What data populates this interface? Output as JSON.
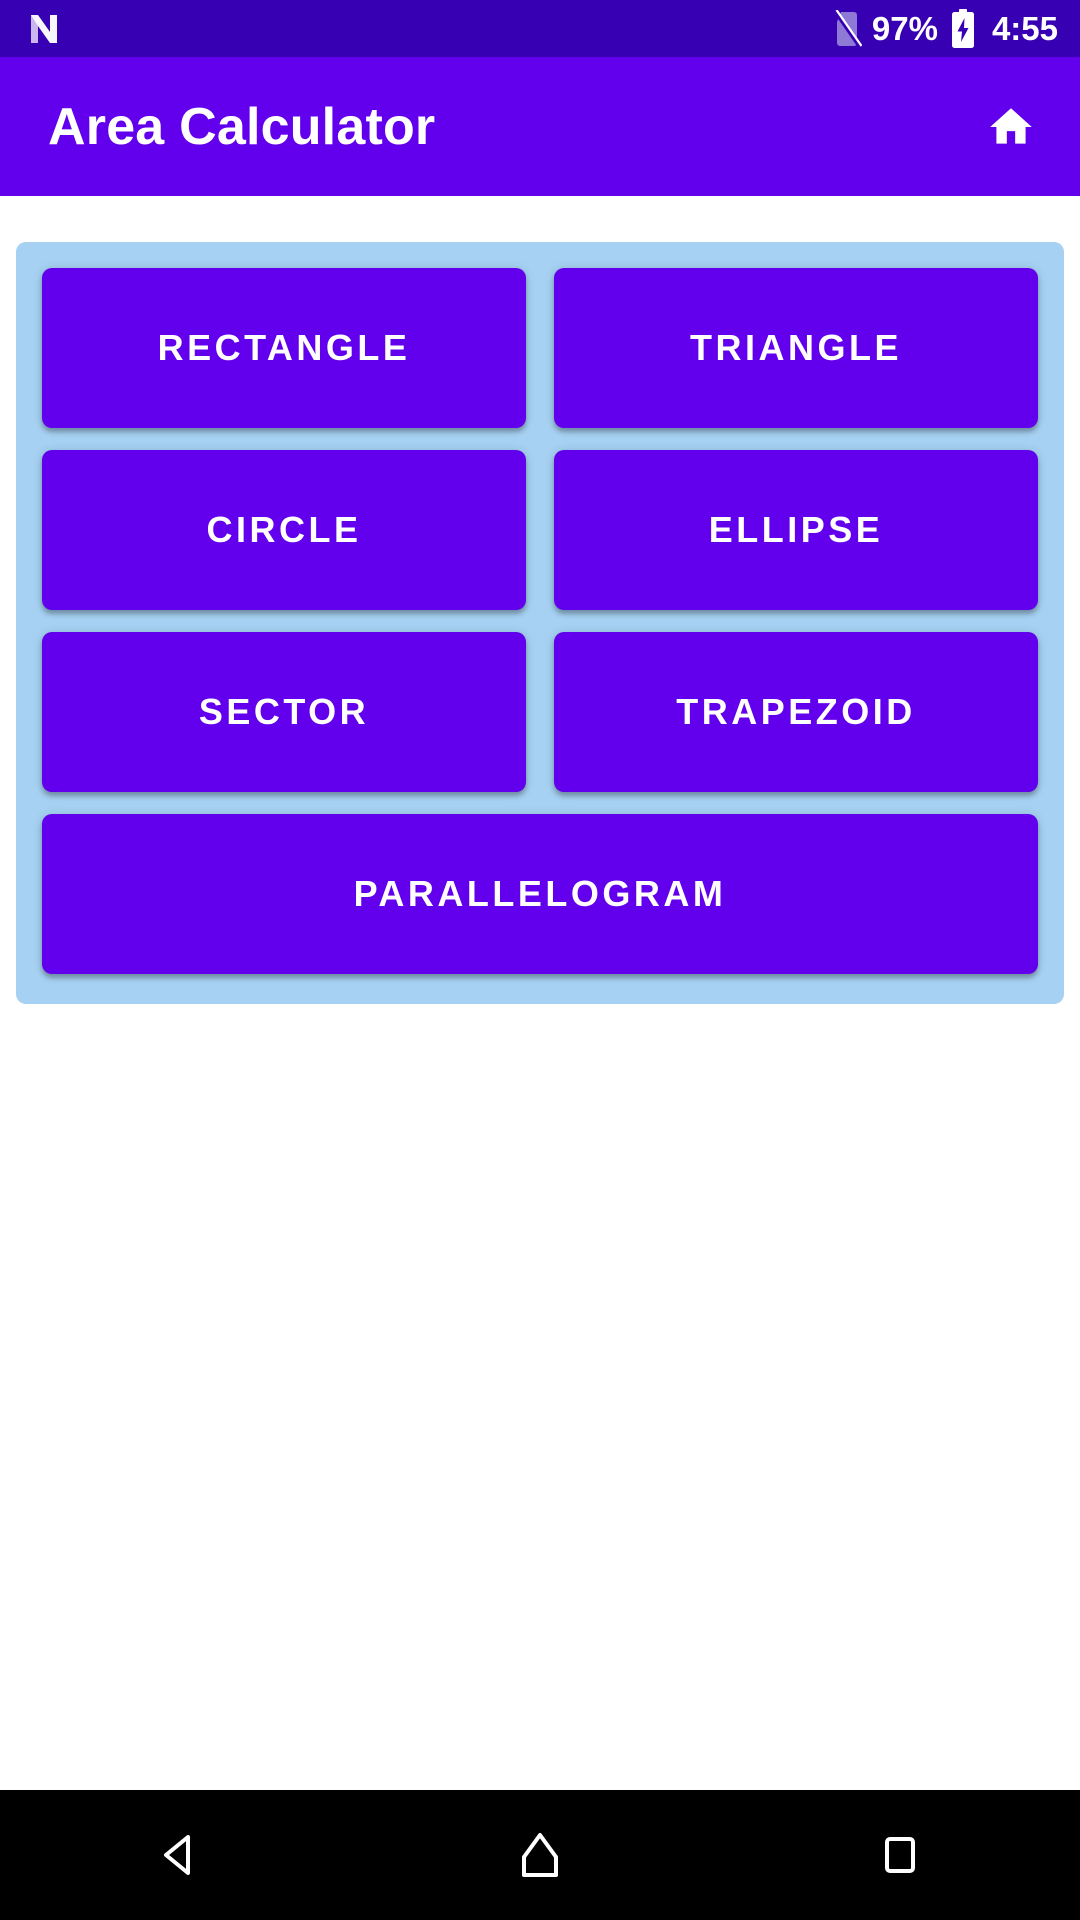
{
  "status_bar": {
    "app_icon": "n-logo-icon",
    "signal_icon": "no-sim-icon",
    "battery_percent": "97%",
    "battery_icon": "battery-charging-icon",
    "time": "4:55",
    "background_color": "#3700b3",
    "text_color": "#ffffff"
  },
  "app_bar": {
    "title": "Area Calculator",
    "home_icon": "home-icon",
    "background_color": "#6200ee",
    "text_color": "#ffffff"
  },
  "main": {
    "panel_color": "#a6d1f2",
    "button_color": "#6200ee",
    "button_text_color": "#ffffff",
    "shape_buttons": [
      {
        "label": "RECTANGLE",
        "span": "half"
      },
      {
        "label": "TRIANGLE",
        "span": "half"
      },
      {
        "label": "CIRCLE",
        "span": "half"
      },
      {
        "label": "ELLIPSE",
        "span": "half"
      },
      {
        "label": "SECTOR",
        "span": "half"
      },
      {
        "label": "TRAPEZOID",
        "span": "half"
      },
      {
        "label": "PARALLELOGRAM",
        "span": "full"
      }
    ]
  },
  "nav_bar": {
    "background_color": "#000000",
    "buttons": [
      {
        "name": "back-icon"
      },
      {
        "name": "home-icon"
      },
      {
        "name": "recents-icon"
      }
    ]
  }
}
